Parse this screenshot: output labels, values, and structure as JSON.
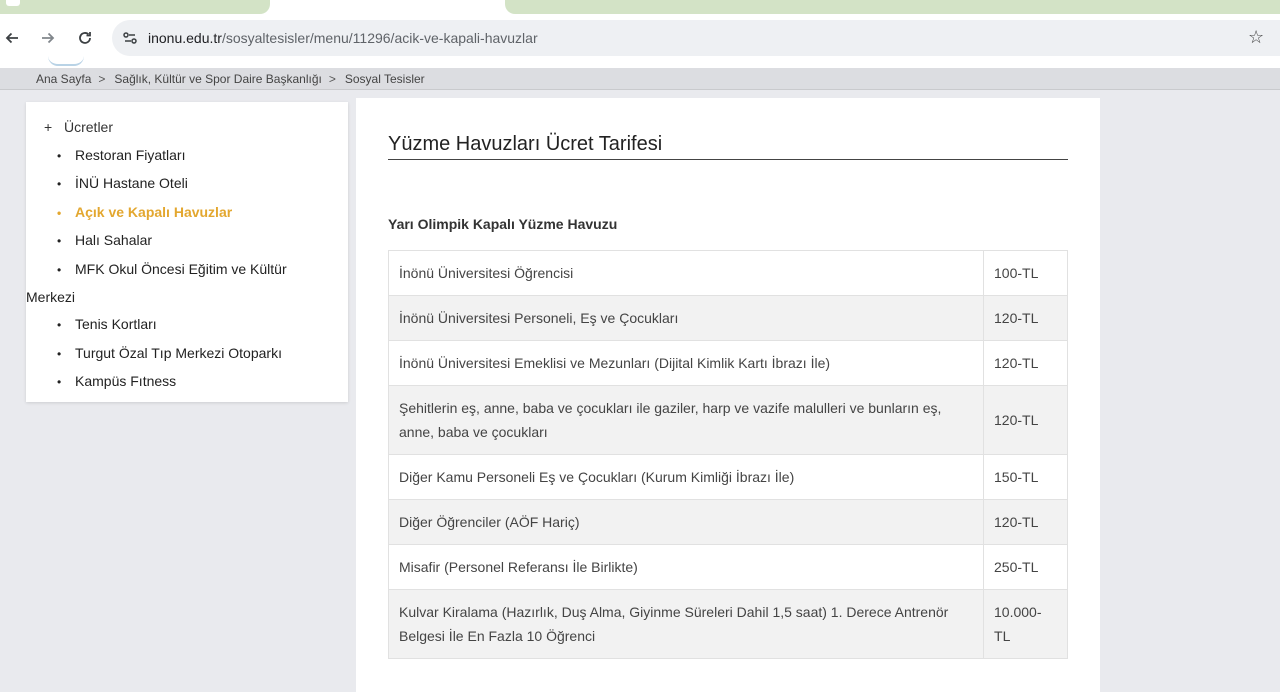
{
  "browser": {
    "url_host": "inonu.edu.tr",
    "url_path": "/sosyaltesisler/menu/11296/acik-ve-kapali-havuzlar"
  },
  "breadcrumb": [
    {
      "label": "Ana Sayfa"
    },
    {
      "label": "Sağlık, Kültür ve Spor Daire Başkanlığı"
    },
    {
      "label": "Sosyal Tesisler"
    }
  ],
  "breadcrumb_separator": ">",
  "sidebar": {
    "header_toggle": "+",
    "header": "Ücretler",
    "items": [
      {
        "label": "Restoran Fiyatları"
      },
      {
        "label": "İNÜ Hastane Oteli"
      },
      {
        "label": "Açık ve Kapalı Havuzlar",
        "active": true
      },
      {
        "label": "Halı Sahalar"
      },
      {
        "label": "MFK Okul Öncesi Eğitim ve Kültür",
        "label_cont": "Merkezi"
      },
      {
        "label": "Tenis Kortları"
      },
      {
        "label": "Turgut Özal Tıp Merkezi Otoparkı"
      },
      {
        "label": "Kampüs Fıtness"
      }
    ],
    "active_color": "#e3a72f"
  },
  "main": {
    "title": "Yüzme Havuzları Ücret Tarifesi",
    "section_title": "Yarı Olimpik Kapalı Yüzme Havuzu",
    "rows": [
      {
        "label": "İnönü Üniversitesi Öğrencisi",
        "price": "100-TL"
      },
      {
        "label": "İnönü Üniversitesi Personeli, Eş ve Çocukları",
        "price": "120-TL"
      },
      {
        "label": "İnönü Üniversitesi Emeklisi ve Mezunları (Dijital Kimlik Kartı İbrazı İle)",
        "price": "120-TL"
      },
      {
        "label": "Şehitlerin eş, anne, baba ve çocukları ile gaziler, harp ve vazife malulleri ve bunların eş, anne, baba ve çocukları",
        "price": "120-TL"
      },
      {
        "label": "Diğer Kamu Personeli Eş ve Çocukları (Kurum Kimliği İbrazı İle)",
        "price": "150-TL"
      },
      {
        "label": "Diğer Öğrenciler (AÖF Hariç)",
        "price": "120-TL"
      },
      {
        "label": "Misafir (Personel Referansı İle Birlikte)",
        "price": "250-TL"
      },
      {
        "label": "Kulvar Kiralama (Hazırlık, Duş Alma, Giyinme Süreleri Dahil 1,5 saat) 1. Derece Antrenör Belgesi İle En Fazla 10 Öğrenci",
        "price": "10.000-TL"
      }
    ]
  },
  "icons": {
    "back": "back-arrow-icon",
    "forward": "forward-arrow-icon",
    "reload": "reload-icon",
    "site_settings": "site-settings-icon",
    "bookmark": "bookmark-star-icon"
  }
}
